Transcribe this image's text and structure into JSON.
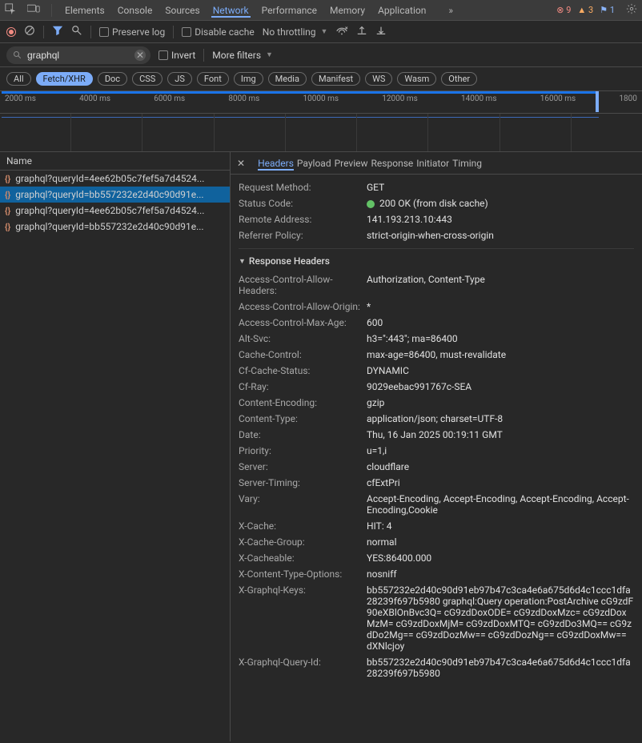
{
  "topTabs": {
    "items": [
      "Elements",
      "Console",
      "Sources",
      "Network",
      "Performance",
      "Memory",
      "Application"
    ],
    "active": "Network",
    "errors": 9,
    "warnings": 3,
    "issues": 1
  },
  "toolbar": {
    "preserve_log": "Preserve log",
    "disable_cache": "Disable cache",
    "throttling": "No throttling"
  },
  "filterrow": {
    "search_value": "graphql",
    "invert": "Invert",
    "more_filters": "More filters"
  },
  "typeChips": [
    "All",
    "Fetch/XHR",
    "Doc",
    "CSS",
    "JS",
    "Font",
    "Img",
    "Media",
    "Manifest",
    "WS",
    "Wasm",
    "Other"
  ],
  "typeChipActive": "Fetch/XHR",
  "timelineTicks": [
    "2000 ms",
    "4000 ms",
    "6000 ms",
    "8000 ms",
    "10000 ms",
    "12000 ms",
    "14000 ms",
    "16000 ms",
    "1800"
  ],
  "leftpane": {
    "header": "Name",
    "rows": [
      "graphql?queryId=4ee62b05c7fef5a7d4524...",
      "graphql?queryId=bb557232e2d40c90d91e...",
      "graphql?queryId=4ee62b05c7fef5a7d4524...",
      "graphql?queryId=bb557232e2d40c90d91e..."
    ],
    "selectedIndex": 1
  },
  "subtabs": {
    "items": [
      "Headers",
      "Payload",
      "Preview",
      "Response",
      "Initiator",
      "Timing"
    ],
    "active": "Headers"
  },
  "general": [
    {
      "k": "Request Method:",
      "v": "GET"
    },
    {
      "k": "Status Code:",
      "v": "200 OK (from disk cache)",
      "status": true
    },
    {
      "k": "Remote Address:",
      "v": "141.193.213.10:443"
    },
    {
      "k": "Referrer Policy:",
      "v": "strict-origin-when-cross-origin"
    }
  ],
  "responseHeadersTitle": "Response Headers",
  "responseHeaders": [
    {
      "k": "Access-Control-Allow-Headers:",
      "v": "Authorization, Content-Type"
    },
    {
      "k": "Access-Control-Allow-Origin:",
      "v": "*"
    },
    {
      "k": "Access-Control-Max-Age:",
      "v": "600"
    },
    {
      "k": "Alt-Svc:",
      "v": "h3=\":443\"; ma=86400"
    },
    {
      "k": "Cache-Control:",
      "v": "max-age=86400, must-revalidate"
    },
    {
      "k": "Cf-Cache-Status:",
      "v": "DYNAMIC"
    },
    {
      "k": "Cf-Ray:",
      "v": "9029eebac991767c-SEA"
    },
    {
      "k": "Content-Encoding:",
      "v": "gzip"
    },
    {
      "k": "Content-Type:",
      "v": "application/json; charset=UTF-8"
    },
    {
      "k": "Date:",
      "v": "Thu, 16 Jan 2025 00:19:11 GMT"
    },
    {
      "k": "Priority:",
      "v": "u=1,i"
    },
    {
      "k": "Server:",
      "v": "cloudflare"
    },
    {
      "k": "Server-Timing:",
      "v": "cfExtPri"
    },
    {
      "k": "Vary:",
      "v": "Accept-Encoding, Accept-Encoding, Accept-Encoding, Accept-Encoding,Cookie"
    },
    {
      "k": "X-Cache:",
      "v": "HIT: 4"
    },
    {
      "k": "X-Cache-Group:",
      "v": "normal"
    },
    {
      "k": "X-Cacheable:",
      "v": "YES:86400.000"
    },
    {
      "k": "X-Content-Type-Options:",
      "v": "nosniff"
    },
    {
      "k": "X-Graphql-Keys:",
      "v": "bb557232e2d40c90d91eb97b47c3ca4e6a675d6d4c1ccc1dfa28239f697b5980 graphql:Query operation:PostArchive cG9zdF90eXBlOnBvc3Q= cG9zdDoxODE= cG9zdDoxMzc= cG9zdDoxMzM= cG9zdDoxMjM= cG9zdDoxMTQ= cG9zdDo3MQ== cG9zdDo2Mg== cG9zdDozMw== cG9zdDozNg== cG9zdDoxMw== dXNlcjoy"
    },
    {
      "k": "X-Graphql-Query-Id:",
      "v": "bb557232e2d40c90d91eb97b47c3ca4e6a675d6d4c1ccc1dfa28239f697b5980"
    }
  ]
}
